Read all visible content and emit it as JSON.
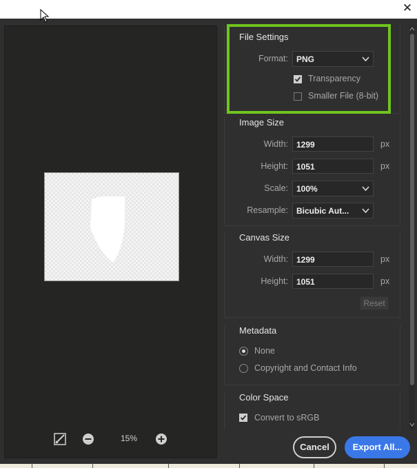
{
  "window": {
    "close_glyph": "✕"
  },
  "preview": {
    "zoom_level": "15%",
    "icons": [
      "toggle-preview-icon",
      "zoom-out-icon",
      "zoom-in-icon"
    ]
  },
  "file_settings": {
    "title": "File Settings",
    "format_label": "Format:",
    "format_value": "PNG",
    "transparency_label": "Transparency",
    "transparency_checked": true,
    "smaller_file_label": "Smaller File (8-bit)",
    "smaller_file_checked": false
  },
  "image_size": {
    "title": "Image Size",
    "width_label": "Width:",
    "width_value": "1299",
    "height_label": "Height:",
    "height_value": "1051",
    "unit": "px",
    "scale_label": "Scale:",
    "scale_value": "100%",
    "resample_label": "Resample:",
    "resample_value": "Bicubic Aut..."
  },
  "canvas_size": {
    "title": "Canvas Size",
    "width_label": "Width:",
    "width_value": "1299",
    "height_label": "Height:",
    "height_value": "1051",
    "unit": "px",
    "reset_label": "Reset"
  },
  "metadata": {
    "title": "Metadata",
    "options": [
      {
        "label": "None",
        "selected": true
      },
      {
        "label": "Copyright and Contact Info",
        "selected": false
      }
    ]
  },
  "color_space": {
    "title": "Color Space",
    "convert_label": "Convert to sRGB",
    "convert_checked": true
  },
  "footer": {
    "cancel_label": "Cancel",
    "export_label": "Export All..."
  },
  "colors": {
    "highlight": "#6fc51e",
    "accent": "#3a78e8",
    "panel_bg": "#2f2f2f",
    "preview_bg": "#252624"
  }
}
